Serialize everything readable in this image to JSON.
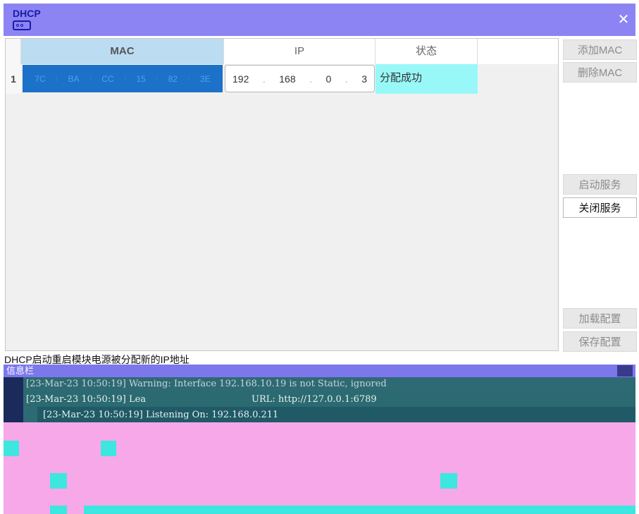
{
  "window": {
    "title": "DHCP",
    "close_label": "✕"
  },
  "table": {
    "headers": [
      "MAC",
      "IP",
      "状态"
    ],
    "rows": [
      {
        "index": "1",
        "mac": [
          "7C",
          "BA",
          "CC",
          "15",
          "82",
          "3E"
        ],
        "ip": [
          "192",
          "168",
          "0",
          "3"
        ],
        "status": "分配成功"
      }
    ]
  },
  "buttons": {
    "add_mac": "添加MAC",
    "delete_mac": "删除MAC",
    "start_service": "启动服务",
    "stop_service": "关闭服务",
    "load_config": "加载配置",
    "save_config": "保存配置"
  },
  "status_line": "DHCP启动重启模块电源被分配新的IP地址",
  "info_panel": {
    "title": "信息栏",
    "log": [
      "[23-Mar-23 10:50:19] Warning: Interface 192.168.10.19 is not Static, ignored",
      "[23-Mar-23 10:50:19] Lea",
      "URL: http://127.0.0.1:6789",
      "[23-Mar-23 10:50:19] Listening On: 192.168.0.211"
    ]
  },
  "colors": {
    "titlebar": "#8c84f2",
    "mac_selected": "#1c72c8",
    "status_ok": "#98f8f8",
    "info_bar": "#7c78ec"
  }
}
